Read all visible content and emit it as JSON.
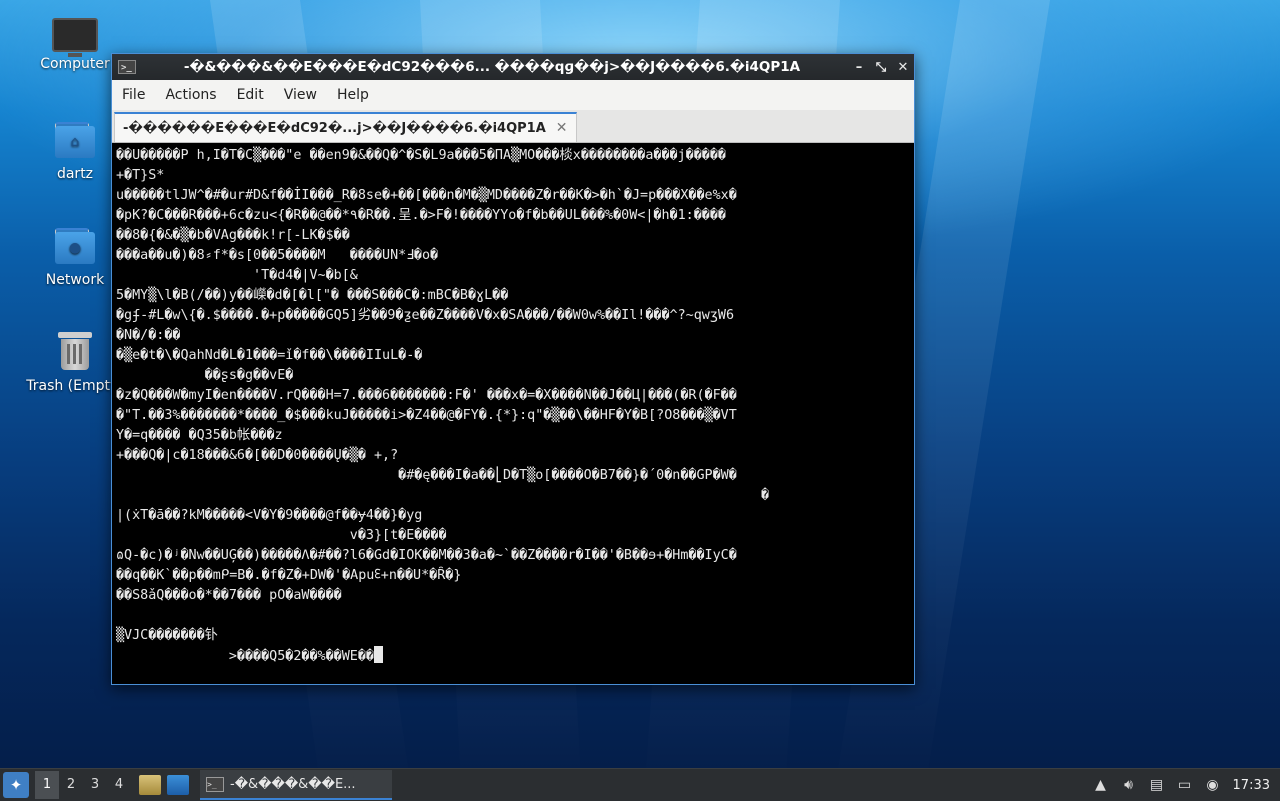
{
  "desktop": {
    "icons": [
      {
        "label": "Computer",
        "icon": "computer-icon"
      },
      {
        "label": "dartz",
        "icon": "home-folder-icon"
      },
      {
        "label": "Network",
        "icon": "network-folder-icon"
      },
      {
        "label": "Trash (Empty)",
        "icon": "trash-icon"
      }
    ]
  },
  "window": {
    "title": "-�&���&��E���E�dC92���6... ����qɡ��j>��J����6.�i4QP1A",
    "controls": {
      "minimize": "–",
      "maximize": "⤡",
      "close": "✕"
    },
    "menu": [
      "File",
      "Actions",
      "Edit",
      "View",
      "Help"
    ],
    "tab_label": "-������E���E�dC92�...j>��J����6.�i4QP1A",
    "tab_close": "✕"
  },
  "terminal": {
    "lines": [
      "��U�����P h,I�T�C▒���\"e ��en9�&��Q�^�S�L9a���5�ПА▒MO���棪x��������a���j�����",
      "+�T}S*",
      "u�����tlJW^�#�ur#D&f��İI���_R�8se�+��[���n�M�▒MD����Z�r��K�>�h`�J=p���X��e%x�",
      "�pK?�C���R���+6c�zu<{�R��@��*٩�R��.呈.�>F�!����YYo�f�b��UL���%�0W<|�h�1:����",
      "��8�{�&�▒�b�VAg���k!r[-LK�$��",
      "���a��u�)�8⸗f*�s[0��5����M   ����UN*Ⅎ�o�",
      "                 'T�d4�|V~�b[&",
      "5�MY▒\\l�B(/��)y��嶸�d�[�l[\"� ���S���C�:mBC�B�ɣL��",
      "�gʄ-#L�w\\{�.$����.�+p�����GQ5]劣��9�ƺe��Z����V�x�SA���/��W0w%��Il!���^?~qwʒW6",
      "�N�/�:��",
      "�▒e�t�\\�QahNd�L�1���=ǐ�f��\\����IIuL�-�",
      "           ��ʂs�g��vE�",
      "�z�Q���W�myI�en����V.rQ���H=7.���6�������:F�' ���x�=�X����N��J��Ц|���(�R(�F��",
      "�\"T.��3%�������*����_�$���kuJ�����i>�Z4��@�FY�.{*}:q\"�▒��\\��HF�Y�B[?O8���▒�VT",
      "Y�=q���� �Q35�b帐���z",
      "+���Q�|c�18���&6�[��D�0����Ų�▒� +,?",
      "                                   �#�ę���I�a��⎣D�T▒o[����O�B7��}�´0�n��GP�W�",
      "                                                                                �",
      "|(ẋT�ā��?kM�����<V�Y�9����@f��ɏ4��}�yg",
      "                             v�3}[t�E����",
      "ɷQ-�c)�ʲ�Nw��UĢ��)�����Λ�#��?l6�Gd�IOK��M��3�a�~`��Z����r�I��'�B��ɘ+�Hm��IyC�",
      "��q��K`��p��mᑭ=B�.�f�Z�+DW�'�Apuᢄ+n��U*�Ȓ�}",
      "��S8ǎQ���o�*��7��� pO�aW����",
      "",
      "▒VJC�������钋",
      "              >����Q5�2��%��WE��"
    ]
  },
  "taskbar": {
    "start_icon": "start-menu-icon",
    "workspaces": [
      "1",
      "2",
      "3",
      "4"
    ],
    "active_workspace": "1",
    "launchers": [
      "file-manager-icon",
      "show-desktop-icon"
    ],
    "task_label": "-�&���&��E...",
    "tray": [
      "tray-up-arrow-icon",
      "volume-icon",
      "clipboard-icon",
      "network-icon",
      "notification-icon"
    ],
    "clock": "17:33"
  }
}
